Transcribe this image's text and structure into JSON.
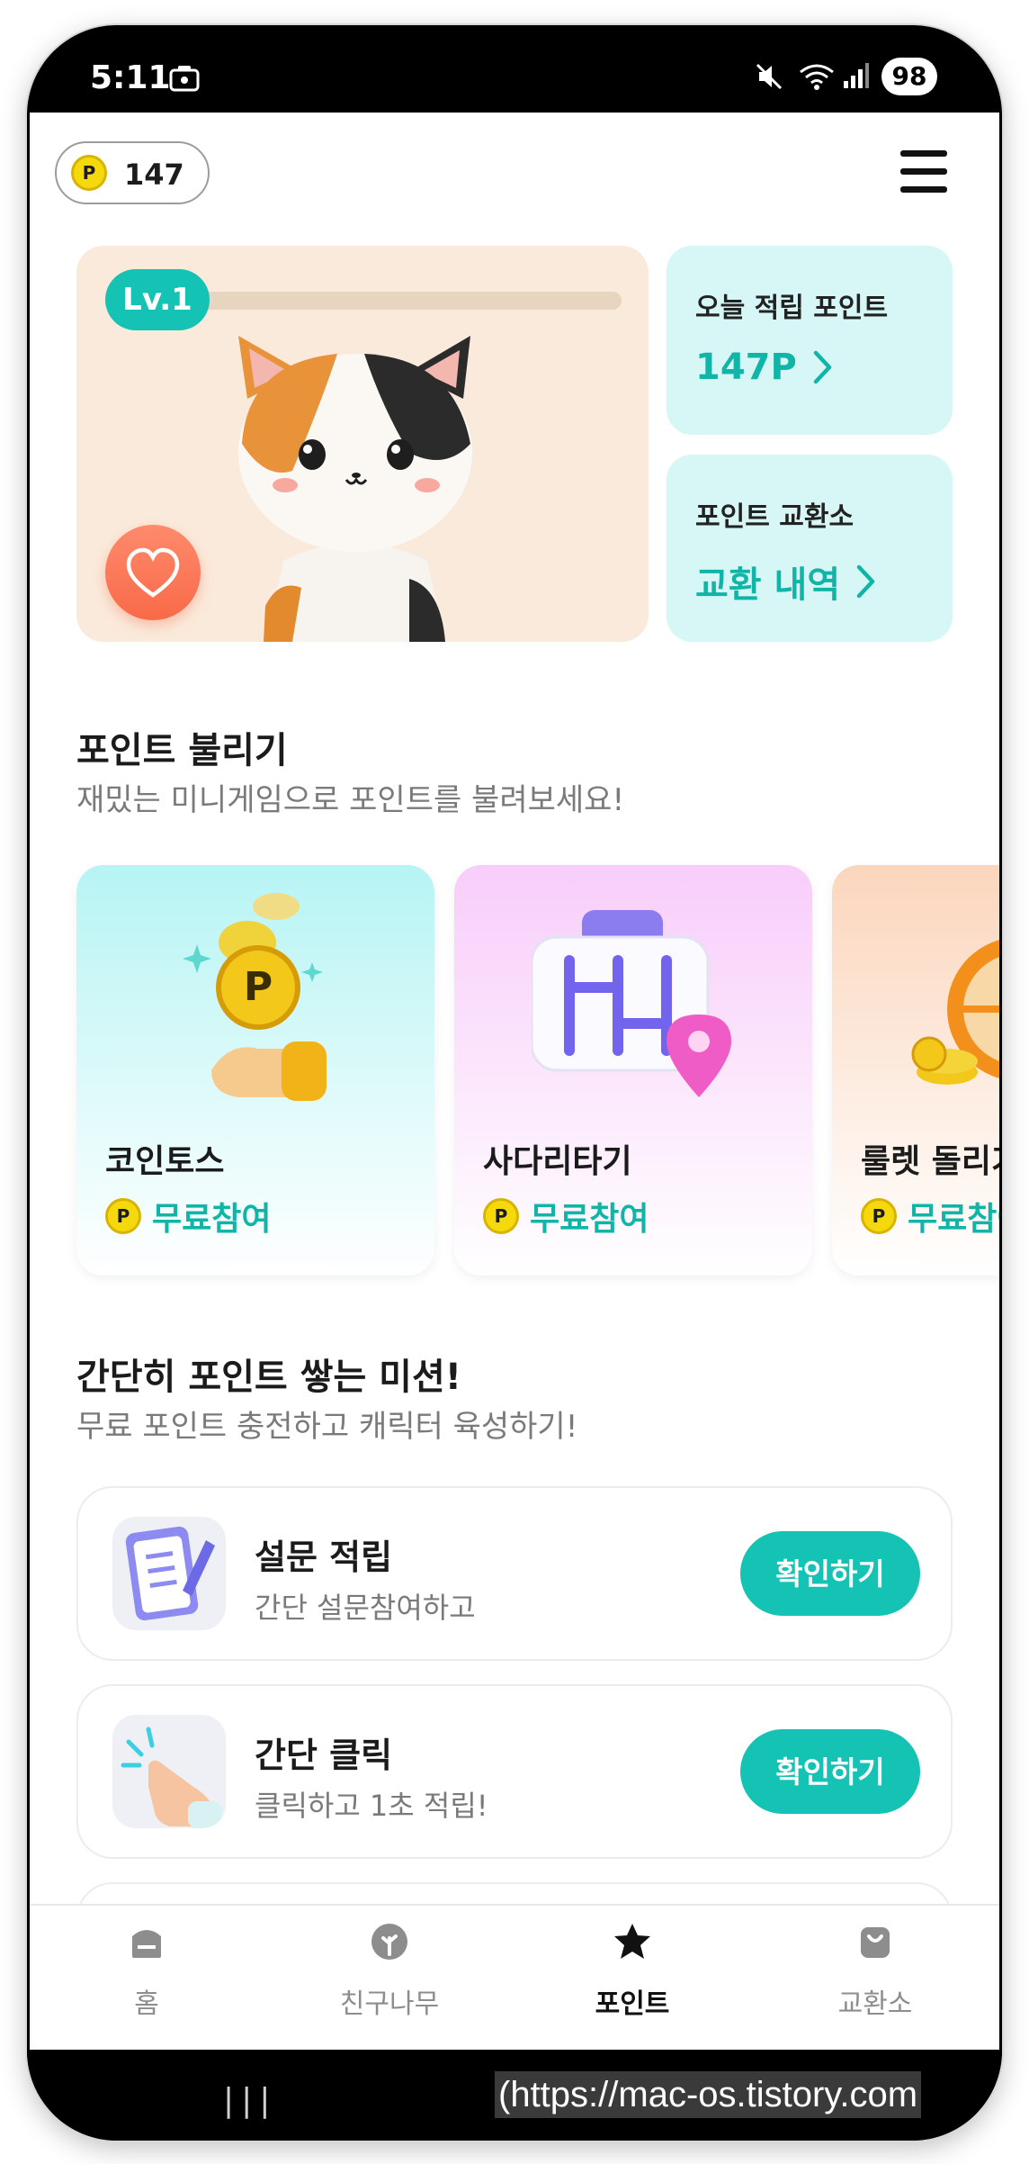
{
  "status_bar": {
    "time": "5:11",
    "battery": "98"
  },
  "header": {
    "point_value": "147",
    "coin_symbol": "P"
  },
  "character": {
    "level_label": "Lv.1",
    "xp_progress": 0.0
  },
  "today_points": {
    "title": "오늘 적립 포인트",
    "value": "147P"
  },
  "exchange": {
    "title": "포인트 교환소",
    "link": "교환 내역"
  },
  "games_section": {
    "title": "포인트 불리기",
    "subtitle": "재밌는 미니게임으로 포인트를 불려보세요!",
    "cards": [
      {
        "name": "코인토스",
        "tag": "무료참여"
      },
      {
        "name": "사다리타기",
        "tag": "무료참여"
      },
      {
        "name": "룰렛 돌리기",
        "tag": "무료참여"
      }
    ]
  },
  "missions_section": {
    "title": "간단히 포인트 쌓는 미션!",
    "subtitle": "무료 포인트 충전하고 캐릭터 육성하기!",
    "items": [
      {
        "title": "설문 적립",
        "subtitle": "간단 설문참여하고",
        "button": "확인하기"
      },
      {
        "title": "간단 클릭",
        "subtitle": "클릭하고 1초 적립!",
        "button": "확인하기"
      }
    ]
  },
  "bottom_nav": [
    {
      "label": "홈",
      "icon": "home-icon"
    },
    {
      "label": "친구나무",
      "icon": "tree-icon"
    },
    {
      "label": "포인트",
      "icon": "star-icon",
      "active": true
    },
    {
      "label": "교환소",
      "icon": "shopping-bag-icon"
    }
  ],
  "system_nav": {
    "recents": "|||"
  },
  "watermark": "(https://mac-os.tistory.com"
}
